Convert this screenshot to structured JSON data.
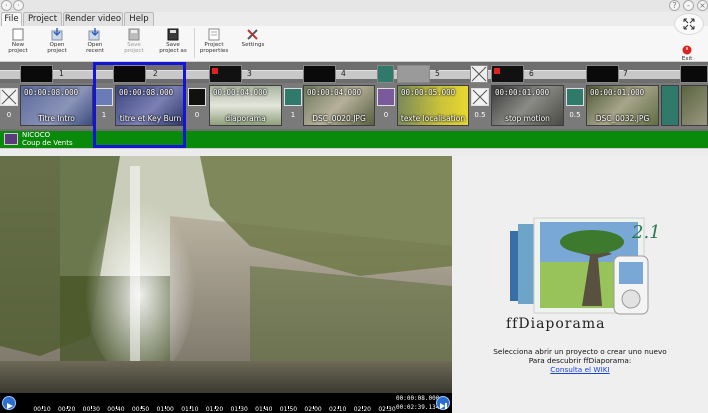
{
  "menu": {
    "tabs": [
      {
        "label": "File"
      },
      {
        "label": "Project"
      },
      {
        "label": "Render video"
      },
      {
        "label": "Help"
      }
    ]
  },
  "ribbon": {
    "new_project": "New\nproject",
    "open_project": "Open\nproject",
    "open_recent": "Open\nrecent",
    "save_project": "Save\nproject",
    "save_project_as": "Save\nproject as",
    "project_properties": "Project\nproperties",
    "settings": "Settings",
    "exit": "Exit"
  },
  "timeline": {
    "slide_numbers": [
      "1",
      "2",
      "3",
      "4",
      "5",
      "6",
      "7"
    ],
    "slides": [
      {
        "duration": "00:00:08.000",
        "name": "Titre Intro"
      },
      {
        "duration": "00:00:08.000",
        "name": "titre et Key Burn"
      },
      {
        "duration": "00:00:04.000",
        "name": "diaporama"
      },
      {
        "duration": "00:00:04.000",
        "name": "DSC_0020.JPG"
      },
      {
        "duration": "00:00:05.000",
        "name": "texte localisation"
      },
      {
        "duration": "00:00:01.000",
        "name": "stop motion"
      },
      {
        "duration": "00:00:01.000",
        "name": "DSC_0032.JPG"
      }
    ],
    "transitions": [
      "0",
      "1",
      "0",
      "1",
      "0",
      "0.5",
      "0.5"
    ],
    "music": {
      "line1": "NICOCO",
      "line2": "Coup de Vents"
    }
  },
  "player": {
    "ticks": [
      "00:10",
      "00:20",
      "00:30",
      "00:40",
      "00:50",
      "01:00",
      "01:10",
      "01:20",
      "01:30",
      "01:40",
      "01:50",
      "02:00",
      "02:10",
      "02:20",
      "02:30"
    ],
    "current_time": "00:00:08.000",
    "total_time": "00:02:39.134"
  },
  "welcome": {
    "logo_version": "2.1",
    "logo_text": "ffDiaporama",
    "line1": "Selecciona abrir un proyecto o crear uno nuevo",
    "line2": "Para descubrir ffDiaporama:",
    "link": "Consulta el WIKI"
  },
  "colors": {
    "selection": "#1414d8",
    "music_track": "#0a8a0a",
    "link": "#1a44d8",
    "player_button": "#2a6fd0"
  }
}
